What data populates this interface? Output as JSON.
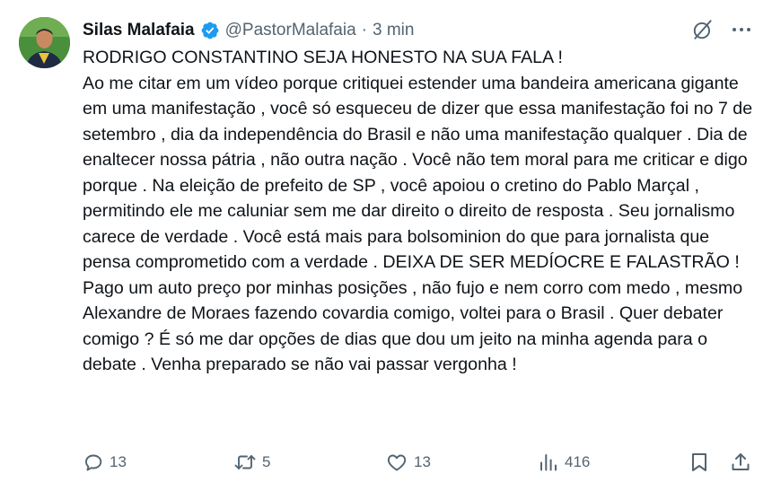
{
  "author": {
    "display_name": "Silas Malafaia",
    "handle": "@PastorMalafaia",
    "separator": "·",
    "time": "3 min",
    "verified": true
  },
  "post": {
    "text": "RODRIGO CONSTANTINO SEJA HONESTO NA SUA FALA !\nAo me citar em um vídeo porque critiquei estender uma bandeira americana gigante em uma manifestação , você só esqueceu de dizer que essa manifestação foi no 7 de setembro , dia da independência do Brasil e não uma manifestação qualquer . Dia de enaltecer nossa pátria , não outra nação . Você não tem moral para me criticar e digo porque . Na eleição de prefeito de SP , você apoiou o cretino do Pablo Marçal , permitindo ele me caluniar sem me dar direito o direito de resposta . Seu jornalismo carece de verdade . Você está mais para bolsominion do que para jornalista que pensa comprometido com a verdade . DEIXA DE SER MEDÍOCRE E FALASTRÃO ! Pago um auto preço por minhas posições , não fujo e nem corro com medo , mesmo Alexandre de Moraes fazendo covardia comigo, voltei para o Brasil . Quer debater comigo ? É só me dar opções de dias que dou um jeito na minha agenda para o debate . Venha preparado se não vai passar vergonha !"
  },
  "metrics": {
    "replies": "13",
    "reposts": "5",
    "likes": "13",
    "views": "416"
  },
  "icons": {
    "verified": "verified-badge-icon",
    "grok": "grok-icon",
    "more": "more-icon",
    "reply": "reply-icon",
    "repost": "repost-icon",
    "like": "like-icon",
    "views": "views-icon",
    "bookmark": "bookmark-icon",
    "share": "share-icon"
  },
  "colors": {
    "text": "#0f1419",
    "secondary": "#536471",
    "verified": "#1d9bf0",
    "background": "#ffffff"
  }
}
